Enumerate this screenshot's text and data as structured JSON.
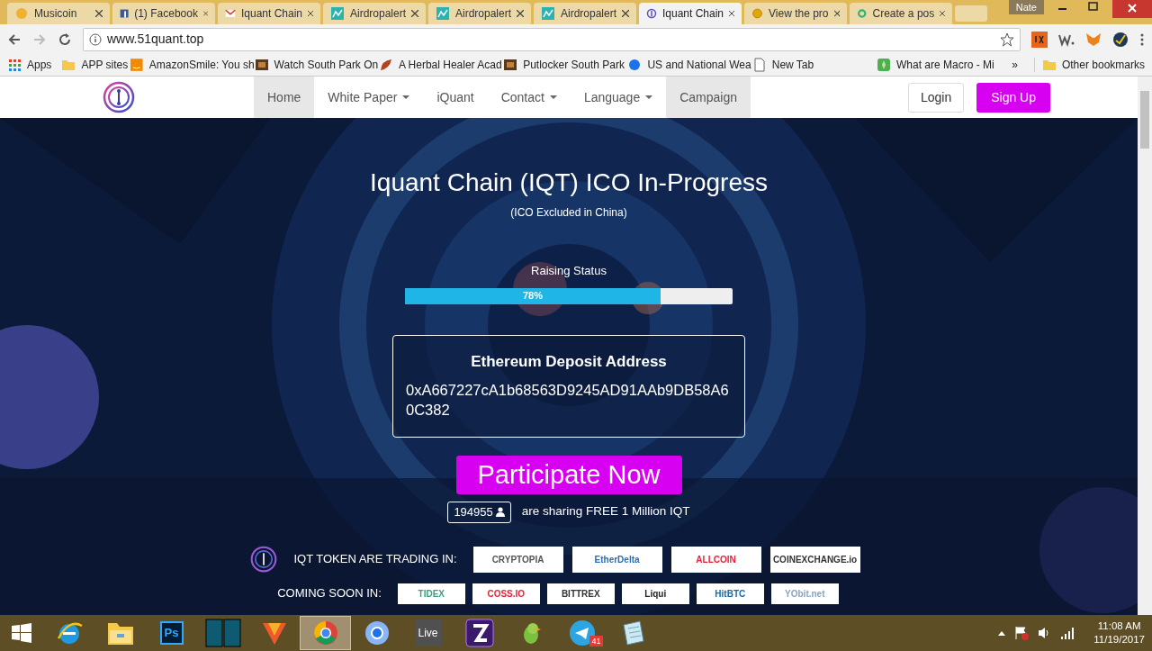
{
  "window": {
    "user": "Nate"
  },
  "tabs": [
    {
      "title": "Musicoin",
      "kind": "musicoin",
      "selected": false
    },
    {
      "title": "(1) Facebook",
      "kind": "facebook",
      "selected": false
    },
    {
      "title": "Iquant Chain",
      "kind": "gmail",
      "selected": false
    },
    {
      "title": "Airdropalert",
      "kind": "chart",
      "selected": false
    },
    {
      "title": "Airdropalert",
      "kind": "chart",
      "selected": false
    },
    {
      "title": "Airdropalert",
      "kind": "chart",
      "selected": false
    },
    {
      "title": "Iquant Chain",
      "kind": "iquant",
      "selected": true
    },
    {
      "title": "View the pro",
      "kind": "coin",
      "selected": false
    },
    {
      "title": "Create a pos",
      "kind": "ring",
      "selected": false
    }
  ],
  "address_bar": {
    "url": "www.51quant.top"
  },
  "bookmarks": [
    {
      "label": "Apps",
      "kind": "apps"
    },
    {
      "label": "APP sites",
      "kind": "folder"
    },
    {
      "label": "AmazonSmile: You sh",
      "kind": "amazon"
    },
    {
      "label": "Watch South Park On",
      "kind": "film"
    },
    {
      "label": "A Herbal Healer Acad",
      "kind": "leaf"
    },
    {
      "label": "Putlocker South Park",
      "kind": "film"
    },
    {
      "label": "US and National Wea",
      "kind": "dot"
    },
    {
      "label": "New Tab",
      "kind": "page"
    },
    {
      "label": "What are Macro - Mi",
      "kind": "plant"
    }
  ],
  "bookmarks_more": "»",
  "other_bookmarks": "Other bookmarks",
  "site_nav": {
    "items": [
      {
        "label": "Home",
        "dropdown": false,
        "selected": true
      },
      {
        "label": "White Paper",
        "dropdown": true,
        "selected": false
      },
      {
        "label": "iQuant",
        "dropdown": false,
        "selected": false
      },
      {
        "label": "Contact",
        "dropdown": true,
        "selected": false
      },
      {
        "label": "Language",
        "dropdown": true,
        "selected": false
      },
      {
        "label": "Campaign",
        "dropdown": false,
        "selected": true
      }
    ],
    "login": "Login",
    "signup": "Sign Up"
  },
  "hero": {
    "title": "Iquant Chain (IQT) ICO In-Progress",
    "subtitle": "(ICO Excluded in China)",
    "raising_label": "Raising Status",
    "progress": {
      "level": 0.78,
      "label": "78%"
    },
    "deposit": {
      "title": "Ethereum Deposit Address",
      "address": "0xA667227cA1b68563D9245AD91AAb9DB58A60C382"
    },
    "cta": "Participate Now",
    "participants": "194955",
    "sharing_text": "are sharing FREE 1 Million IQT",
    "trading_label": "IQT TOKEN ARE TRADING IN:",
    "trading": [
      {
        "name": "CRYPTOPIA",
        "color": "#555555"
      },
      {
        "name": "EtherDelta",
        "color": "#2a6ebb"
      },
      {
        "name": "ALLCOIN",
        "color": "#e8223a"
      },
      {
        "name": "COINEXCHANGE.io",
        "color": "#333333"
      }
    ],
    "coming_label": "COMING SOON IN:",
    "coming": [
      {
        "name": "TIDEX",
        "color": "#3aa17e"
      },
      {
        "name": "COSS.IO",
        "color": "#e8223a"
      },
      {
        "name": "BITTREX",
        "color": "#333333"
      },
      {
        "name": "Liqui",
        "color": "#222222"
      },
      {
        "name": "HitBTC",
        "color": "#1a6aa0"
      },
      {
        "name": "YObit.net",
        "color": "#8aa4c0"
      }
    ]
  },
  "taskbar": {
    "apps": [
      {
        "kind": "ie",
        "selected": false
      },
      {
        "kind": "explorer",
        "selected": false
      },
      {
        "kind": "ps",
        "label": "Ps",
        "selected": false
      },
      {
        "kind": "panel",
        "selected": false
      },
      {
        "kind": "vivaldi",
        "selected": false
      },
      {
        "kind": "chrome",
        "selected": true
      },
      {
        "kind": "chromium",
        "selected": false
      },
      {
        "kind": "live",
        "label": "Live",
        "selected": false
      },
      {
        "kind": "game",
        "selected": false
      },
      {
        "kind": "parrot",
        "selected": false
      },
      {
        "kind": "telegram",
        "badge": "41",
        "selected": false
      },
      {
        "kind": "notepad",
        "selected": false
      }
    ],
    "time": "11:08 AM",
    "date": "11/19/2017"
  }
}
